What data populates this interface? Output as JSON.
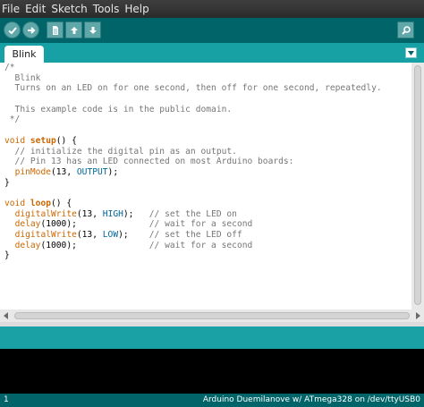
{
  "menu": [
    "File",
    "Edit",
    "Sketch",
    "Tools",
    "Help"
  ],
  "toolbar": {
    "buttons": [
      {
        "name": "verify-button",
        "icon": "checkmark-icon"
      },
      {
        "name": "upload-button",
        "icon": "right-arrow-icon"
      },
      {
        "name": "new-button",
        "icon": "new-document-icon"
      },
      {
        "name": "open-button",
        "icon": "up-arrow-icon"
      },
      {
        "name": "save-button",
        "icon": "down-arrow-icon"
      },
      {
        "name": "serial-monitor-button",
        "icon": "magnifier-icon"
      }
    ],
    "accent_color": "#006468"
  },
  "tabs": [
    {
      "label": "Blink"
    }
  ],
  "editor": {
    "lines": [
      "/*",
      "  Blink",
      "  Turns on an LED on for one second, then off for one second, repeatedly.",
      "",
      "  This example code is in the public domain.",
      " */",
      "",
      "void setup() {",
      "  // initialize the digital pin as an output.",
      "  // Pin 13 has an LED connected on most Arduino boards:",
      "  pinMode(13, OUTPUT);",
      "}",
      "",
      "void loop() {",
      "  digitalWrite(13, HIGH);   // set the LED on",
      "  delay(1000);              // wait for a second",
      "  digitalWrite(13, LOW);    // set the LED off",
      "  delay(1000);              // wait for a second",
      "}"
    ]
  },
  "status": {
    "line_number": "1",
    "board": "Arduino Duemilanove w/ ATmega328 on /dev/ttyUSB0"
  }
}
